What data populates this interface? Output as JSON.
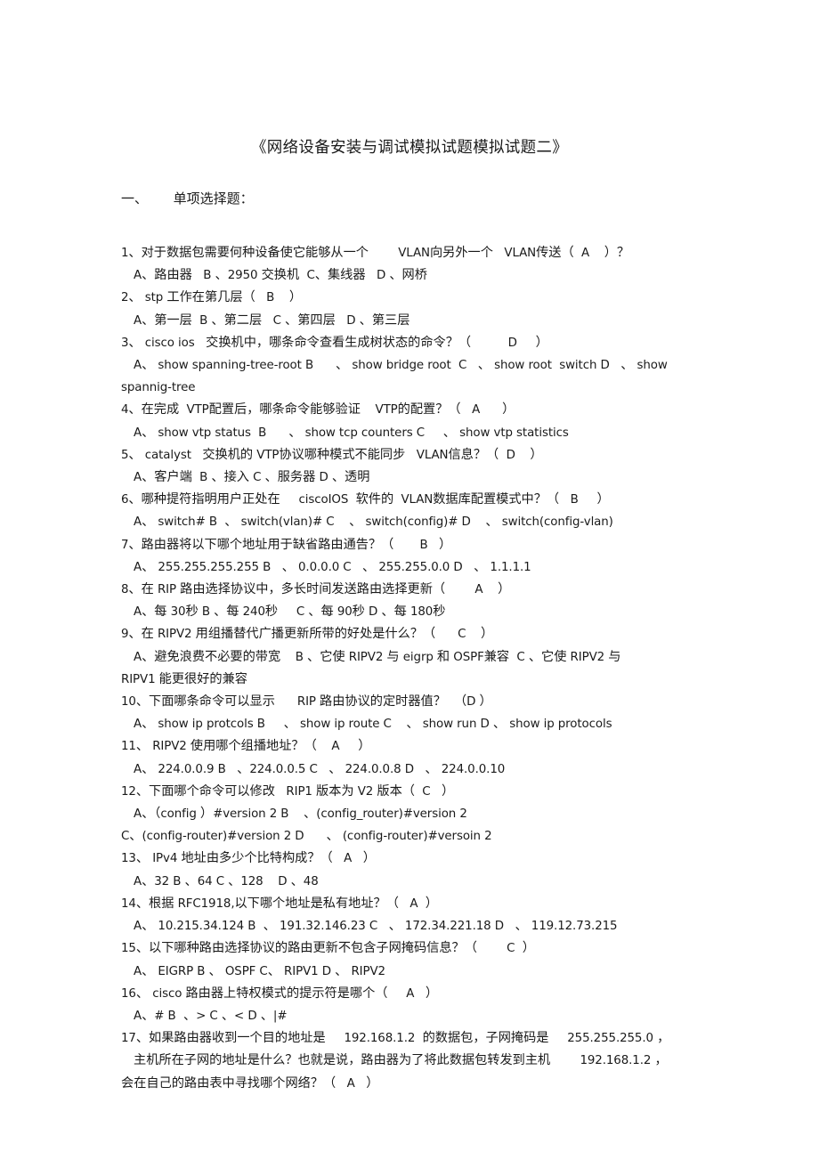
{
  "document": {
    "title": "《网络设备安装与调试模拟试题模拟试题二》",
    "section_heading": "一、      单项选择题："
  },
  "questions": [
    {
      "number": "1",
      "stem": "1、对于数据包需要何种设备使它能够从一个        VLAN向另外一个   VLAN传送（  A    ）？",
      "answer": "A",
      "options_lines": [
        "A、路由器   B 、2950 交换机  C、集线器   D 、网桥"
      ]
    },
    {
      "number": "2",
      "stem": "2、 stp 工作在第几层（   B    ）",
      "answer": "B",
      "options_lines": [
        "A、第一层  B 、第二层   C 、第四层   D 、第三层"
      ]
    },
    {
      "number": "3",
      "stem": "3、 cisco ios   交换机中，哪条命令查看生成树状态的命令？（          D     ）",
      "answer": "D",
      "options_lines": [
        "A、 show spanning-tree-root B      、 show bridge root  C   、 show root  switch D   、 show",
        "spannig-tree"
      ]
    },
    {
      "number": "4",
      "stem": "4、在完成  VTP配置后，哪条命令能够验证    VTP的配置？（   A      ）",
      "answer": "A",
      "options_lines": [
        "A、 show vtp status  B      、 show tcp counters C     、 show vtp statistics"
      ]
    },
    {
      "number": "5",
      "stem": "5、 catalyst   交换机的 VTP协议哪种模式不能同步   VLAN信息？（  D    ）",
      "answer": "D",
      "options_lines": [
        "A、客户端  B 、接入 C 、服务器 D 、透明"
      ]
    },
    {
      "number": "6",
      "stem": "6、哪种提符指明用户正处在     ciscoIOS  软件的  VLAN数据库配置模式中？（   B     ）",
      "answer": "B",
      "options_lines": [
        "A、 switch# B  、 switch(vlan)# C    、 switch(config)# D    、 switch(config-vlan)"
      ]
    },
    {
      "number": "7",
      "stem": "7、路由器将以下哪个地址用于缺省路由通告？（       B   ）",
      "answer": "B",
      "options_lines": [
        "A、 255.255.255.255 B   、 0.0.0.0 C   、 255.255.0.0 D   、 1.1.1.1"
      ]
    },
    {
      "number": "8",
      "stem": "8、在 RIP 路由选择协议中，多长时间发送路由选择更新（        A    ）",
      "answer": "A",
      "options_lines": [
        "A、每 30秒 B 、每 240秒     C 、每 90秒 D 、每 180秒"
      ]
    },
    {
      "number": "9",
      "stem": "9、在 RIPV2 用组播替代广播更新所带的好处是什么？（      C    ）",
      "answer": "C",
      "options_lines": [
        "A、避免浪费不必要的带宽    B 、它使 RIPV2 与 eigrp 和 OSPF兼容  C 、它使 RIPV2 与",
        "RIPV1 能更很好的兼容"
      ]
    },
    {
      "number": "10",
      "stem": "10、下面哪条命令可以显示      RIP 路由协议的定时器值？  （D ）",
      "answer": "D",
      "options_lines": [
        "A、 show ip protcols B     、 show ip route C    、 show run D 、 show ip protocols"
      ]
    },
    {
      "number": "11",
      "stem": "11、 RIPV2 使用哪个组播地址？（    A     ）",
      "answer": "A",
      "options_lines": [
        "A、 224.0.0.9 B   、224.0.0.5 C   、 224.0.0.8 D   、 224.0.0.10"
      ]
    },
    {
      "number": "12",
      "stem": "12、下面哪个命令可以修改   RIP1 版本为 V2 版本（  C   ）",
      "answer": "C",
      "options_lines": [
        "A、（config ）#version 2 B    、(config_router)#version 2",
        "C、(config-router)#version 2 D      、 (config-router)#versoin 2"
      ]
    },
    {
      "number": "13",
      "stem": "13、 IPv4 地址由多少个比特构成？（   A   ）",
      "answer": "A",
      "options_lines": [
        "A、32 B 、64 C 、128    D 、48"
      ]
    },
    {
      "number": "14",
      "stem": "14、根据 RFC1918,以下哪个地址是私有地址？（   A  ）",
      "answer": "A",
      "options_lines": [
        "A、 10.215.34.124 B  、 191.32.146.23 C   、 172.34.221.18 D   、 119.12.73.215"
      ]
    },
    {
      "number": "15",
      "stem": "15、以下哪种路由选择协议的路由更新不包含子网掩码信息？（        C  ）",
      "answer": "C",
      "options_lines": [
        "A、 EIGRP B 、 OSPF C、 RIPV1 D 、 RIPV2"
      ]
    },
    {
      "number": "16",
      "stem": "16、 cisco 路由器上特权模式的提示符是哪个（     A   ）",
      "answer": "A",
      "options_lines": [
        "A、# B  、> C 、< D 、|#"
      ]
    },
    {
      "number": "17",
      "stem": "17、如果路由器收到一个目的地址是     192.168.1.2  的数据包，子网掩码是     255.255.255.0 ，",
      "answer": "A",
      "options_lines": [
        "主机所在子网的地址是什么？也就是说，路由器为了将此数据包转发到主机        192.168.1.2 ，",
        "会在自己的路由表中寻找哪个网络？（   A   ）"
      ]
    }
  ]
}
